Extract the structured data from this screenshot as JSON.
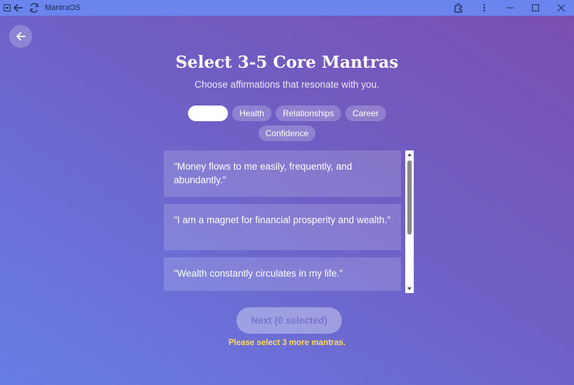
{
  "window": {
    "title": "MantraOS"
  },
  "header": {
    "title": "Select 3-5 Core Mantras",
    "subtitle": "Choose affirmations that resonate with you."
  },
  "categories": [
    {
      "label": "",
      "active": true
    },
    {
      "label": "Health",
      "active": false
    },
    {
      "label": "Relationships",
      "active": false
    },
    {
      "label": "Career",
      "active": false
    },
    {
      "label": "Confidence",
      "active": false
    }
  ],
  "mantras": [
    "\"Money flows to me easily, frequently, and abundantly.\"",
    "\"I am a magnet for financial prosperity and wealth.\"",
    "\"Wealth constantly circulates in my life.\""
  ],
  "actions": {
    "next_label": "Next (0 selected)",
    "warning": "Please select 3 more mantras."
  },
  "colors": {
    "gradient_top": "#7a4fb0",
    "gradient_bottom": "#667ee6",
    "warning": "#ffd95a",
    "titlebar": "#6a86ee"
  }
}
